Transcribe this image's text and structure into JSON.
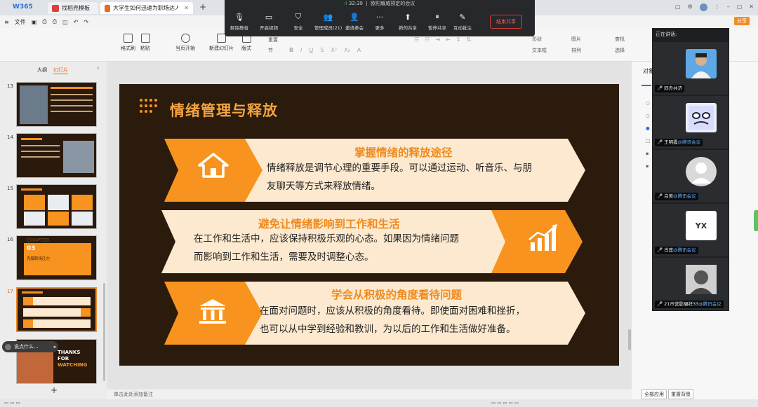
{
  "titlebar": {
    "app_name": "W365",
    "tabs": [
      {
        "label": "找稻壳模板",
        "color": "#d9413c"
      },
      {
        "label": "大学生如何迅速为职场达人.pptx",
        "color": "#e86a1f"
      }
    ],
    "new_tab": "+",
    "share_label": "分享"
  },
  "menubar": {
    "file_label": "文件"
  },
  "meeting": {
    "timer": "32:39",
    "status_text": "欧阳耀威预定的会议",
    "buttons": [
      {
        "label": "解除静音",
        "icon": "mic-muted-icon"
      },
      {
        "label": "开启视频",
        "icon": "camera-off-icon"
      },
      {
        "label": "安全",
        "icon": "shield-icon"
      },
      {
        "label": "管理成员(21)",
        "icon": "members-icon"
      },
      {
        "label": "邀请参会",
        "icon": "invite-icon"
      },
      {
        "label": "更多",
        "icon": "more-icon"
      },
      {
        "label": "新的共享",
        "icon": "share-icon"
      },
      {
        "label": "暂停共享",
        "icon": "pause-share-icon"
      },
      {
        "label": "互动批注",
        "icon": "annotate-icon"
      }
    ],
    "end_share": "结束共享"
  },
  "ribbon": {
    "format_painter": "格式刷",
    "paste": "粘贴",
    "play_from_current": "当页开始",
    "new_slide": "新建幻灯片",
    "layout": "版式",
    "section": "节",
    "reset": "重置",
    "shape": "形状",
    "picture": "图片",
    "textbox": "文本框",
    "arrange": "排列",
    "find": "查找",
    "select": "选择"
  },
  "leftpanel": {
    "tab_outline": "大纲",
    "tab_slides": "幻灯片",
    "slides": [
      {
        "num": "13"
      },
      {
        "num": "14"
      },
      {
        "num": "15"
      },
      {
        "num": "16",
        "chapter_num": "03",
        "chapter_title": "克服职场压力",
        "chapter_word": "CHAPTER"
      },
      {
        "num": "17"
      },
      {
        "num": "",
        "thanks": "THANKS",
        "for": "FOR",
        "watching": "WATCHING"
      }
    ],
    "add_slide": "+",
    "chat_bubble": "说点什么..."
  },
  "slide": {
    "title": "情绪管理与释放",
    "bands": [
      {
        "heading": "掌握情绪的释放途径",
        "lines": [
          "情绪释放是调节心理的重要手段。可以通过运动、听音乐、与朋",
          "友聊天等方式来释放情绪。"
        ],
        "icon": "house-icon"
      },
      {
        "heading": "避免让情绪影响到工作和生活",
        "lines": [
          "在工作和生活中，应该保持积极乐观的心态。如果因为情绪问题",
          "而影响到工作和生活，需要及时调整心态。"
        ],
        "icon": "chart-icon"
      },
      {
        "heading": "学会从积极的角度看待问题",
        "lines": [
          "在面对问题时，应该从积极的角度看待。即使面对困难和挫折，",
          "也可以从中学到经验和教训，为以后的工作和生活做好准备。"
        ],
        "icon": "bank-icon"
      }
    ],
    "colors": {
      "bg": "#2b1b0d",
      "accent": "#f7931e",
      "band": "#fde9cf"
    }
  },
  "notes": {
    "placeholder": "单击此处添加备注"
  },
  "rightpanel": {
    "object_label": "对象",
    "apply_all": "全部应用",
    "reset_bg": "重置背景"
  },
  "speaker_panel": {
    "title": "正在讲话:",
    "participants": [
      {
        "name": "同舟共济",
        "org": ""
      },
      {
        "name": "王明霞",
        "org": "@腾讯会议"
      },
      {
        "name": "白美",
        "org": "@腾讯会议"
      },
      {
        "name": "肖莲",
        "org": "@腾讯会议",
        "initials": "YX"
      },
      {
        "name": "21市营影碾祥33",
        "org": "@腾讯会议"
      }
    ]
  }
}
